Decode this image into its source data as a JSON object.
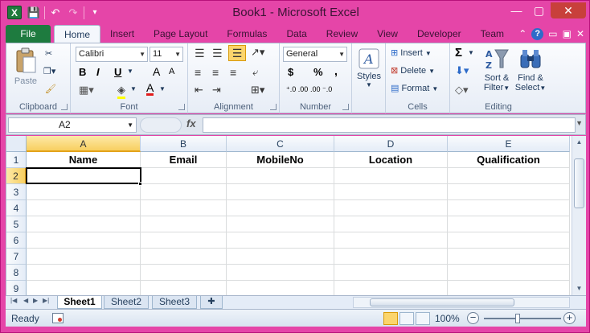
{
  "window": {
    "title": "Book1  -  Microsoft Excel",
    "app_icon_letter": "X"
  },
  "qat": {
    "save": "💾",
    "undo": "↶",
    "redo": "↷",
    "customize": "▾"
  },
  "window_buttons": {
    "minimize": "—",
    "maximize": "▢",
    "close": "✕"
  },
  "tabs": {
    "file": "File",
    "items": [
      "Home",
      "Insert",
      "Page Layout",
      "Formulas",
      "Data",
      "Review",
      "View",
      "Developer",
      "Team"
    ]
  },
  "tab_right": {
    "collapse": "⌃",
    "help": "?",
    "min": "▭",
    "restore": "▣",
    "close": "✕"
  },
  "ribbon": {
    "clipboard": {
      "label": "Clipboard",
      "paste": "Paste"
    },
    "font": {
      "label": "Font",
      "font_name": "Calibri",
      "font_size": "11",
      "bold": "B",
      "italic": "I",
      "underline": "U",
      "grow": "A",
      "shrink": "A",
      "font_color": "A"
    },
    "alignment": {
      "label": "Alignment"
    },
    "number": {
      "label": "Number",
      "format": "General",
      "currency": "$",
      "percent": "%",
      "comma": ",",
      "inc_dec": "⁺.0 .00",
      "dec_dec": ".00 ⁻.0"
    },
    "styles": {
      "label": "Styles"
    },
    "cells": {
      "label": "Cells",
      "insert": "Insert",
      "delete": "Delete",
      "format": "Format"
    },
    "editing": {
      "label": "Editing",
      "sum": "Σ",
      "sort": "Sort &",
      "sort2": "Filter",
      "find": "Find &",
      "find2": "Select"
    }
  },
  "formula_bar": {
    "name_box": "A2",
    "fx": "fx",
    "value": ""
  },
  "columns": [
    "A",
    "B",
    "C",
    "D",
    "E"
  ],
  "rows": [
    "1",
    "2",
    "3",
    "4",
    "5",
    "6",
    "7",
    "8",
    "9"
  ],
  "cells": {
    "A1": "Name",
    "B1": "Email",
    "C1": "MobileNo",
    "D1": "Location",
    "E1": "Qualification"
  },
  "sheets": [
    "Sheet1",
    "Sheet2",
    "Sheet3"
  ],
  "status": {
    "ready": "Ready",
    "zoom": "100%",
    "zoom_out": "−",
    "zoom_in": "+"
  },
  "colors": {
    "accent": "#e545a8",
    "file_tab": "#1e7b3f",
    "selection": "#f8cf60"
  }
}
